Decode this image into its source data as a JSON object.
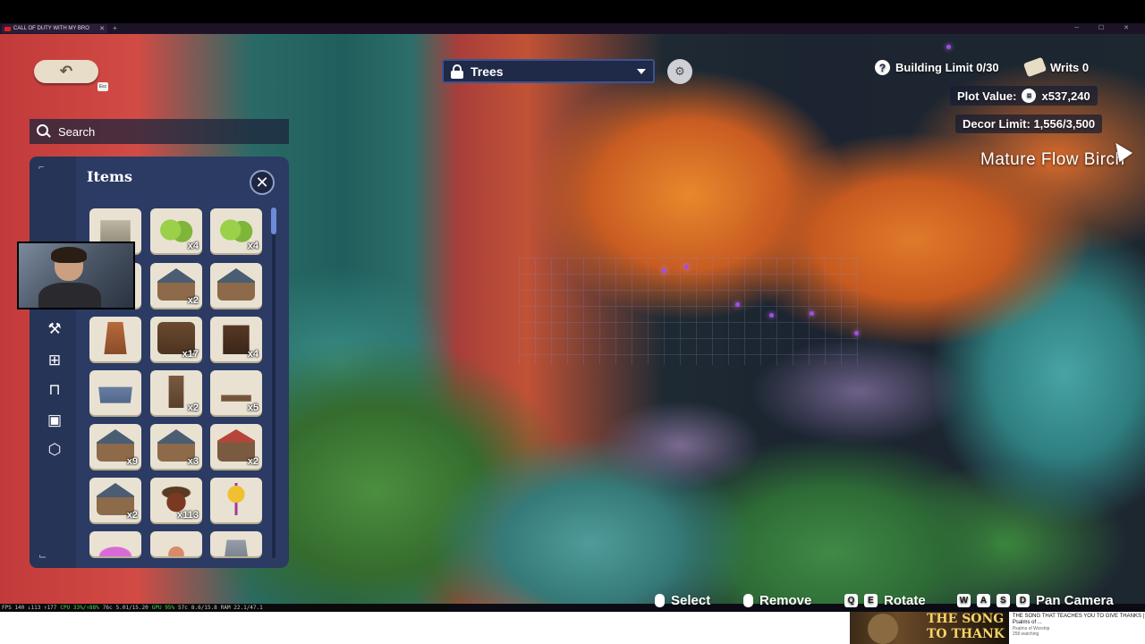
{
  "browser": {
    "tab_title": "CALL OF DUTY WITH MY BRO",
    "tab_close": "✕",
    "new_tab": "+",
    "window_controls": "─ ☐ ✕"
  },
  "hud": {
    "back_icon": "undo-arrow-icon",
    "back_glyph": "↶",
    "esc_label": "Esc",
    "search_label": "Search",
    "category": {
      "label": "Trees",
      "icon": "lock-icon"
    },
    "settings_glyph": "⚙",
    "help_glyph": "?",
    "building_limit": "Building Limit 0/30",
    "writs": "Writs 0",
    "plot_value_label": "Plot Value:",
    "plot_value": "x537,240",
    "decor_limit": "Decor Limit: 1,556/3,500",
    "hover_item_name": "Mature Flow Birch"
  },
  "items_panel": {
    "title": "Items",
    "close_glyph": "✕",
    "sidebar_icons": [
      {
        "name": "crafting-station-icon",
        "glyph": "⚒"
      },
      {
        "name": "fence-icon",
        "glyph": "⊞"
      },
      {
        "name": "furniture-icon",
        "glyph": "⊓"
      },
      {
        "name": "decor-icon",
        "glyph": "▣"
      },
      {
        "name": "storage-box-icon",
        "glyph": "⬡"
      }
    ],
    "tiles": [
      {
        "art": "fence",
        "qty": ""
      },
      {
        "art": "bush",
        "qty": "x4"
      },
      {
        "art": "bush",
        "qty": "x4"
      },
      {
        "art": "house",
        "qty": ""
      },
      {
        "art": "house",
        "qty": "x2"
      },
      {
        "art": "house",
        "qty": ""
      },
      {
        "art": "stove",
        "qty": ""
      },
      {
        "art": "shed",
        "qty": "x17"
      },
      {
        "art": "shelf",
        "qty": "x4"
      },
      {
        "art": "tub",
        "qty": ""
      },
      {
        "art": "door",
        "qty": "x2"
      },
      {
        "art": "dock",
        "qty": "x5"
      },
      {
        "art": "house",
        "qty": "x9"
      },
      {
        "art": "house",
        "qty": "x3"
      },
      {
        "art": "stall",
        "qty": "x2"
      },
      {
        "art": "house",
        "qty": "x2"
      },
      {
        "art": "acorn",
        "qty": "x113"
      },
      {
        "art": "sapling",
        "qty": ""
      },
      {
        "art": "pink",
        "qty": ""
      },
      {
        "art": "fox",
        "qty": ""
      },
      {
        "art": "armor",
        "qty": ""
      }
    ]
  },
  "prompts": {
    "select": "Select",
    "remove": "Remove",
    "rotate_keys": [
      "Q",
      "E"
    ],
    "rotate": "Rotate",
    "pan_keys": [
      "W",
      "A",
      "S",
      "D"
    ],
    "pan": "Pan Camera"
  },
  "osd": {
    "fps": "FPS 140 ↓113 ↑177",
    "cpu": "CPU 33%/↑88%",
    "gpu_temp": "76c",
    "gpu_mem": "5.01/15.20",
    "gpu": "GPU 95%",
    "gpu_temp2": "57c",
    "vram": "8.6/15.8",
    "ram": "RAM 22.1/47.1"
  },
  "youtube_card": {
    "thumb_line1": "THE SONG",
    "thumb_line2": "TO THANK",
    "title": "THE SONG THAT TEACHES YOU TO GIVE THANKS | Psalms of ...",
    "channel": "Psalms of Worship",
    "views": "258 watching"
  },
  "colors": {
    "panel": "#2b3b63",
    "sidebar": "#263457",
    "category_border": "#3d5290",
    "accent_spark": "#a24de6"
  }
}
